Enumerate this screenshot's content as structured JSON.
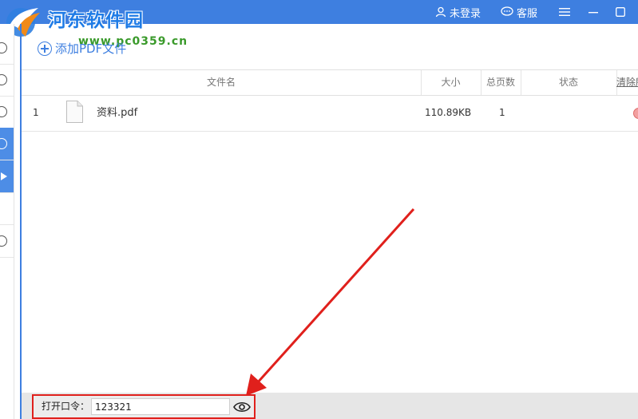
{
  "titlebar": {
    "watermark_title": "河东软件园",
    "watermark_url": "www.pc0359.cn",
    "login_label": "未登录",
    "service_label": "客服",
    "bg_color": "#3e7fe0"
  },
  "toolbar": {
    "add_pdf_label": "添加PDF文件"
  },
  "table": {
    "columns": [
      "文件名",
      "大小",
      "总页数",
      "状态",
      "清除所"
    ],
    "rows": [
      {
        "index": "1",
        "name": "资料.pdf",
        "size": "110.89KB",
        "pages": "1",
        "status": ""
      }
    ]
  },
  "password": {
    "label": "打开口令：",
    "value": "123321"
  },
  "icons": [
    "user-icon",
    "chat-icon",
    "menu-icon",
    "minimize-icon",
    "maximize-icon",
    "file-icon",
    "eye-icon",
    "delete-icon"
  ],
  "colors": {
    "accent": "#3e7fe0",
    "highlight": "#e0201c"
  }
}
